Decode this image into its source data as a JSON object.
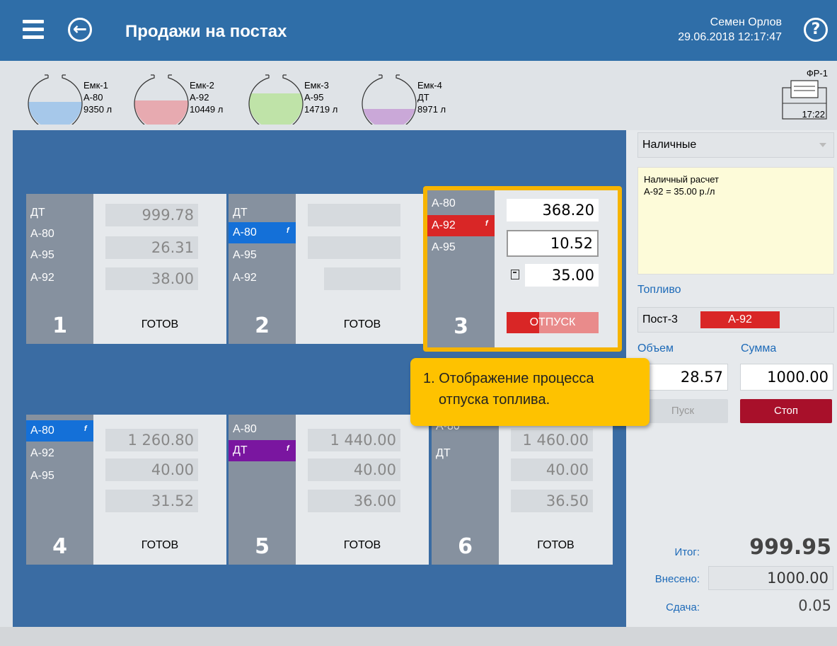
{
  "header": {
    "title": "Продажи на постах",
    "user_name": "Семен Орлов",
    "datetime": "29.06.2018 12:17:47",
    "help_icon": "?"
  },
  "tanks": [
    {
      "name": "Емк-1",
      "fuel": "А-80",
      "volume": "9350 л",
      "color": "#a6c8ea",
      "level": 0.33
    },
    {
      "name": "Емк-2",
      "fuel": "А-92",
      "volume": "10449 л",
      "color": "#e7aab0",
      "level": 0.36
    },
    {
      "name": "Емк-3",
      "fuel": "А-95",
      "volume": "14719 л",
      "color": "#bfe3a8",
      "level": 0.55
    },
    {
      "name": "Емк-4",
      "fuel": "ДТ",
      "volume": "8971 л",
      "color": "#caa8d8",
      "level": 0.2
    }
  ],
  "printer": {
    "label": "ФР-1",
    "time": "17:22"
  },
  "pumps": [
    {
      "number": "1",
      "status": "ГОТОВ",
      "nozzles": [
        "ДТ",
        "А-80",
        "А-95",
        "А-92"
      ],
      "fields": [
        "999.78",
        "26.31",
        "38.00"
      ]
    },
    {
      "number": "2",
      "status": "ГОТОВ",
      "nozzles": [
        "ДТ",
        "А-80",
        "А-95",
        "А-92"
      ],
      "fields": [
        "",
        "",
        ""
      ]
    },
    {
      "number": "3",
      "status": "ОТПУСК",
      "nozzles": [
        "А-80",
        "А-92",
        "А-95"
      ],
      "fields": [
        "368.20",
        "10.52",
        "35.00"
      ],
      "progress": 0.35
    },
    {
      "number": "4",
      "status": "ГОТОВ",
      "nozzles": [
        "А-80",
        "А-92",
        "А-95"
      ],
      "fields": [
        "1 260.80",
        "40.00",
        "31.52"
      ]
    },
    {
      "number": "5",
      "status": "ГОТОВ",
      "nozzles": [
        "А-80",
        "ДТ"
      ],
      "fields": [
        "1 440.00",
        "40.00",
        "36.00"
      ]
    },
    {
      "number": "6",
      "status": "ГОТОВ",
      "nozzles": [
        "А-80",
        "ДТ"
      ],
      "fields": [
        "1 460.00",
        "40.00",
        "36.50"
      ]
    }
  ],
  "tooltip": {
    "line1": "1. Отображение процесса",
    "line2": "отпуска топлива."
  },
  "panel": {
    "payment_type": "Наличные",
    "note_line1": "Наличный расчет",
    "note_line2": "А-92 = 35.00 р./л",
    "fuel_section": "Топливо",
    "post": "Пост-3",
    "fuel": "А-92",
    "volume_label": "Объем",
    "sum_label": "Сумма",
    "volume": "28.57",
    "sum": "1000.00",
    "start_btn": "Пуск",
    "stop_btn": "Стоп",
    "total_label": "Итог:",
    "total": "999.95",
    "paid_label": "Внесено:",
    "paid": "1000.00",
    "change_label": "Сдача:",
    "change": "0.05"
  },
  "colors": {
    "accent_blue": "#2f6ea8",
    "active_blue": "#1470d8",
    "active_red": "#d92626",
    "active_purple": "#7a16a0",
    "highlight": "#f6b400",
    "stop": "#a8102a"
  }
}
